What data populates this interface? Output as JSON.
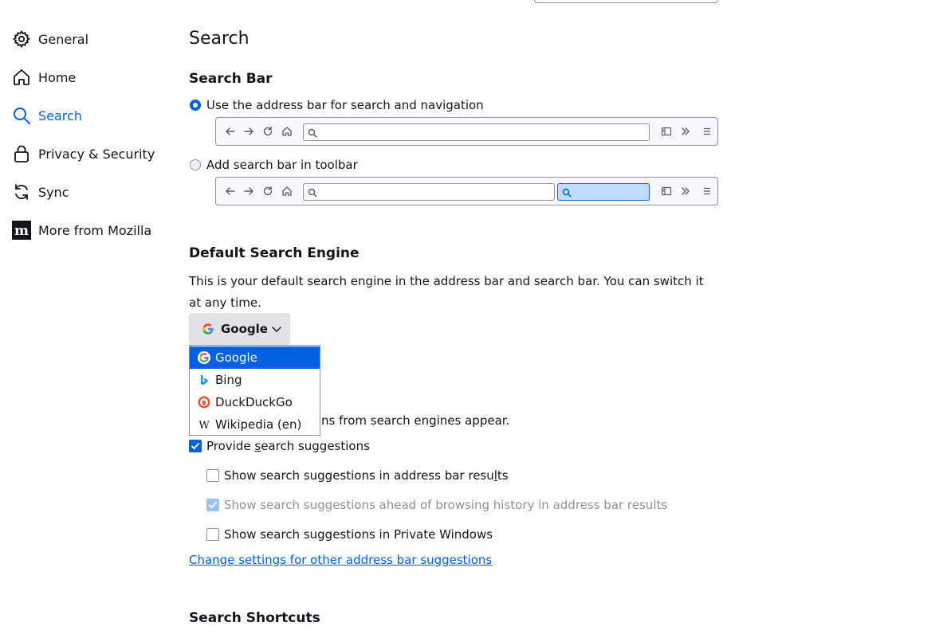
{
  "sidebar": {
    "items": [
      {
        "label": "General",
        "icon": "gear-icon"
      },
      {
        "label": "Home",
        "icon": "home-icon"
      },
      {
        "label": "Search",
        "icon": "search-icon"
      },
      {
        "label": "Privacy & Security",
        "icon": "lock-icon"
      },
      {
        "label": "Sync",
        "icon": "sync-icon"
      },
      {
        "label": "More from Mozilla",
        "icon": "mozilla-icon"
      }
    ],
    "active": "Search"
  },
  "main": {
    "title": "Search",
    "search_bar": {
      "heading": "Search Bar",
      "option_address": "Use the address bar for search and navigation",
      "option_toolbar": "Add search bar in toolbar",
      "selected": "Use the address bar for search and navigation"
    },
    "default_engine": {
      "heading": "Default Search Engine",
      "description": "This is your default search engine in the address bar and search bar. You can switch it at any time.",
      "selected": "Google",
      "options": [
        "Google",
        "Bing",
        "DuckDuckGo",
        "Wikipedia (en)"
      ]
    },
    "suggestions": {
      "partial_text": "ns from search engines appear.",
      "provide_pre": "Provide ",
      "provide_accel": "s",
      "provide_post": "earch suggestions",
      "provide_checked": true,
      "addr_pre": "Show search suggestions in address bar resu",
      "addr_accel": "l",
      "addr_post": "ts",
      "addr_checked": false,
      "ahead": "Show search suggestions ahead of browsing history in address bar results",
      "ahead_checked": true,
      "private": "Show search suggestions in Private Windows",
      "private_checked": false,
      "link": "Change settings for other address bar suggestions"
    },
    "shortcuts_heading": "Search Shortcuts"
  },
  "colors": {
    "accent": "#0061e0",
    "text": "#15141a",
    "border": "#8f8f9d"
  }
}
